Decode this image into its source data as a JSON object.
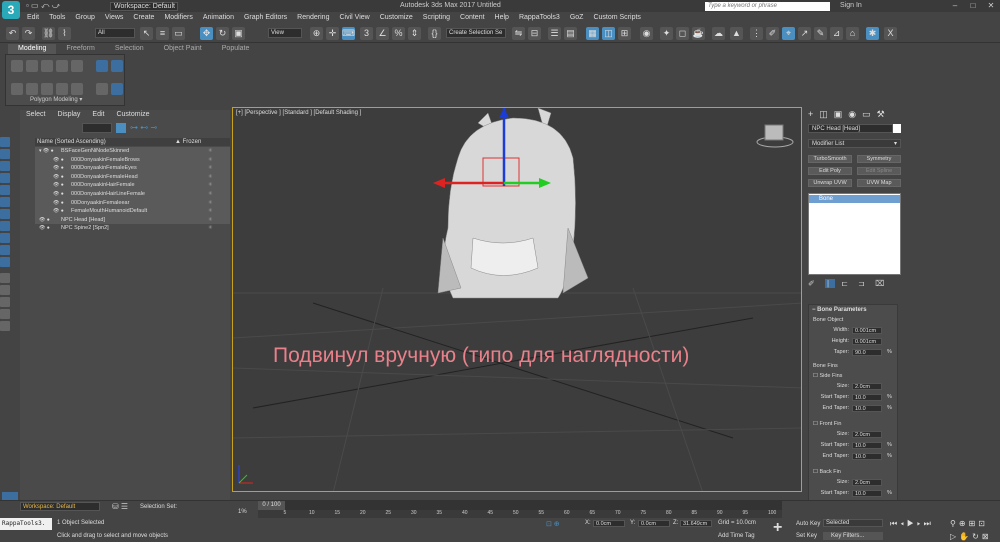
{
  "titlebar": {
    "workspace": "Workspace: Default",
    "title": "Autodesk 3ds Max 2017     Untitled",
    "search_placeholder": "Type a keyword or phrase",
    "sign_in": "Sign In"
  },
  "menu": [
    "Edit",
    "Tools",
    "Group",
    "Views",
    "Create",
    "Modifiers",
    "Animation",
    "Graph Editors",
    "Rendering",
    "Civil View",
    "Customize",
    "Scripting",
    "Content",
    "Help",
    "RappaTools3",
    "GoZ",
    "Custom Scripts"
  ],
  "toolbar": {
    "filter_dd": "All",
    "view_dd": "View",
    "selection_set_dd": "Create Selection Se"
  },
  "ribbon": {
    "tabs": [
      "Modeling",
      "Freeform",
      "Selection",
      "Object Paint",
      "Populate"
    ],
    "panel_label": "Polygon Modeling"
  },
  "explorer": {
    "menu": [
      "Select",
      "Display",
      "Edit",
      "Customize"
    ],
    "col_name": "Name (Sorted Ascending)",
    "col_frozen": "▲ Frozen",
    "rows": [
      {
        "label": "BSFaceGenNiNodeSkinned",
        "indent": 0,
        "sel": true
      },
      {
        "label": "000DonyaakinFemaleBrows",
        "indent": 1,
        "sel": true
      },
      {
        "label": "000DonyaakinFemaleEyes",
        "indent": 1,
        "sel": true
      },
      {
        "label": "000DonyaakinFemaleHead",
        "indent": 1,
        "sel": true
      },
      {
        "label": "000DonyaakinHairFemale",
        "indent": 1,
        "sel": true
      },
      {
        "label": "000DonyaakinHairLineFemale",
        "indent": 1,
        "sel": true
      },
      {
        "label": "00DonyaakinFemaleear",
        "indent": 1,
        "sel": true
      },
      {
        "label": "FemaleMouthHumanoidDefault",
        "indent": 1,
        "sel": true
      },
      {
        "label": "NPC Head [Head]",
        "indent": 0,
        "sel": true
      },
      {
        "label": "NPC Spine2 [Spn2]",
        "indent": 0,
        "sel": false
      }
    ]
  },
  "viewport": {
    "label": "[+] [Perspective ] [Standard ] [Default Shading ]",
    "overlay_text": "Подвинул вручную (типо для наглядности)"
  },
  "command_panel": {
    "object_name": "NPC Head [Head]",
    "modifier_list": "Modifier List",
    "buttons": [
      {
        "label": "TurboSmooth",
        "dim": false
      },
      {
        "label": "Symmetry",
        "dim": false
      },
      {
        "label": "Edit Poly",
        "dim": false
      },
      {
        "label": "Edit Spline",
        "dim": true
      },
      {
        "label": "Unwrap UVW",
        "dim": false
      },
      {
        "label": "UVW Map",
        "dim": false
      }
    ],
    "stack_item": "Bone",
    "bone_params": {
      "title": "Bone Parameters",
      "bone_object": "Bone Object",
      "width_label": "Width:",
      "width": "0.001cm",
      "height_label": "Height:",
      "height": "0.001cm",
      "taper_label": "Taper:",
      "taper": "90.0",
      "bone_fins": "Bone Fins",
      "side_fins": "Side Fins",
      "front_fin": "Front Fin",
      "back_fin": "Back Fin",
      "size_label": "Size:",
      "size": "2.0cm",
      "start_taper_label": "Start Taper:",
      "start_taper": "10.0",
      "end_taper_label": "End Taper:",
      "end_taper": "10.0",
      "pct": "%"
    }
  },
  "bottom": {
    "workspace": "Workspace: Default",
    "selection_set": "Selection Set:",
    "time": "0 / 100",
    "ticks": [
      "5",
      "10",
      "15",
      "20",
      "25",
      "30",
      "35",
      "40",
      "45",
      "50",
      "55",
      "60",
      "65",
      "70",
      "75",
      "80",
      "85",
      "90",
      "95",
      "100"
    ],
    "script_box": "RappaTools3.",
    "status1": "1 Object Selected",
    "status2": "Click and drag to select and move objects",
    "x_label": "X:",
    "x": "0.0cm",
    "y_label": "Y:",
    "y": "0.0cm",
    "z_label": "Z:",
    "z": "31.649cm",
    "grid": "Grid = 10.0cm",
    "add_time_tag": "Add Time Tag",
    "auto_key": "Auto Key",
    "set_key": "Set Key",
    "selected": "Selected",
    "key_filters": "Key Filters..."
  }
}
